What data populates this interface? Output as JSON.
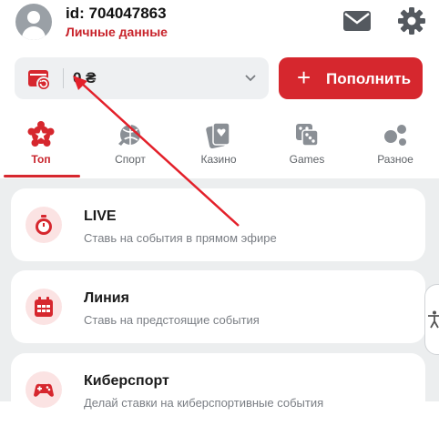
{
  "header": {
    "user_id": "id: 704047863",
    "personal_data_link": "Личные данные"
  },
  "balance": {
    "value": "0 ₴",
    "deposit_label": "Пополнить"
  },
  "tabs": [
    {
      "label": "Топ",
      "icon": "star-badge-icon",
      "active": true
    },
    {
      "label": "Спорт",
      "icon": "sports-ball-icon",
      "active": false
    },
    {
      "label": "Казино",
      "icon": "playing-card-icon",
      "active": false
    },
    {
      "label": "Games",
      "icon": "dice-icon",
      "active": false
    },
    {
      "label": "Разное",
      "icon": "dots-icon",
      "active": false
    }
  ],
  "cards": [
    {
      "title": "LIVE",
      "description": "Ставь на события в прямом эфире",
      "icon": "stopwatch-icon"
    },
    {
      "title": "Линия",
      "description": "Ставь на предстоящие события",
      "icon": "calendar-icon"
    },
    {
      "title": "Киберспорт",
      "description": "Делай ставки на киберспортивные события",
      "icon": "gamepad-icon"
    }
  ],
  "colors": {
    "accent": "#d6272e",
    "text_muted": "#7a7e84",
    "background_gray": "#eceeef",
    "annotation_arrow": "#e3202a"
  }
}
